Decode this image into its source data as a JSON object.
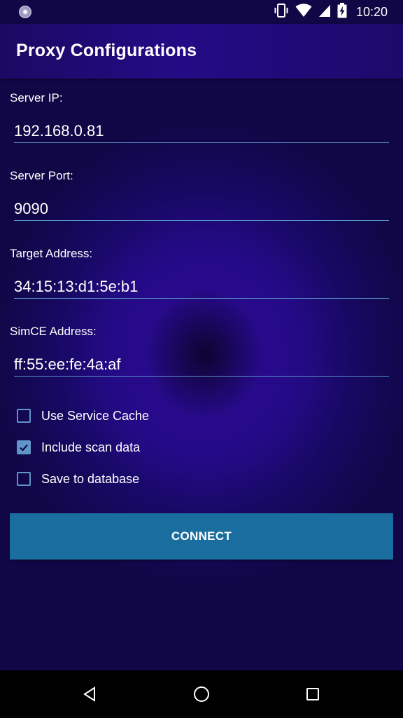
{
  "status_bar": {
    "time": "10:20",
    "icons": [
      "app-notification-icon",
      "vibrate-icon",
      "wifi-icon",
      "signal-icon",
      "battery-charging-icon"
    ]
  },
  "app_bar": {
    "title": "Proxy Configurations"
  },
  "form": {
    "server_ip": {
      "label": "Server IP:",
      "value": "192.168.0.81"
    },
    "server_port": {
      "label": "Server Port:",
      "value": "9090"
    },
    "target_address": {
      "label": "Target Address:",
      "value": "34:15:13:d1:5e:b1"
    },
    "simce_address": {
      "label": "SimCE Address:",
      "value": "ff:55:ee:fe:4a:af"
    }
  },
  "options": [
    {
      "label": "Use Service Cache",
      "checked": false
    },
    {
      "label": "Include scan data",
      "checked": true
    },
    {
      "label": "Save to database",
      "checked": false
    }
  ],
  "connect_button": {
    "label": "CONNECT"
  },
  "nav_bar": {
    "icons": [
      "back-icon",
      "home-icon",
      "recents-icon"
    ]
  },
  "colors": {
    "background": "#14084e",
    "app_bar": "#240b86",
    "accent": "#5f95c8",
    "button": "#1a6d9f"
  }
}
